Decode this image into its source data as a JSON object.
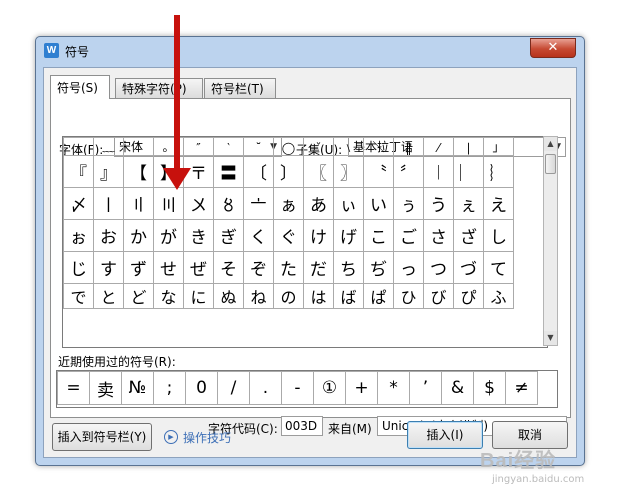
{
  "window": {
    "title": "符号",
    "app_icon_letter": "W",
    "close_glyph": "✕"
  },
  "tabs": [
    {
      "label": "符号(S)",
      "active": true
    },
    {
      "label": "特殊字符(P)",
      "active": false
    },
    {
      "label": "符号栏(T)",
      "active": false
    }
  ],
  "font": {
    "label": "字体(F):",
    "value": "宋体"
  },
  "subset": {
    "label": "子集(U):",
    "value": "基本拉丁语"
  },
  "symbol_grid": {
    "partial_top": [
      "﹍",
      "﹏",
      "ˋ",
      "。",
      "″",
      "‵",
      "˘",
      "◯",
      "ˇ",
      "﹨",
      "＼",
      "‖",
      "⁄",
      "∣",
      "」",
      "╰"
    ],
    "rows": [
      [
        "『",
        "』",
        "【",
        "】",
        "〒",
        "〓",
        "〔",
        "〕",
        "〖",
        "〗",
        "〝",
        "〞",
        "︱",
        "︳",
        "︴"
      ],
      [
        "〆",
        "〡",
        "〢",
        "〣",
        "〤",
        "〥",
        "〦",
        "ぁ",
        "あ",
        "ぃ",
        "い",
        "ぅ",
        "う",
        "ぇ",
        "え"
      ],
      [
        "ぉ",
        "お",
        "か",
        "が",
        "き",
        "ぎ",
        "く",
        "ぐ",
        "け",
        "げ",
        "こ",
        "ご",
        "さ",
        "ざ",
        "し"
      ],
      [
        "じ",
        "す",
        "ず",
        "せ",
        "ぜ",
        "そ",
        "ぞ",
        "た",
        "だ",
        "ち",
        "ぢ",
        "っ",
        "つ",
        "づ",
        "て"
      ]
    ],
    "partial_bottom": [
      "で",
      "と",
      "ど",
      "な",
      "に",
      "ぬ",
      "ね",
      "の",
      "は",
      "ば",
      "ぱ",
      "ひ",
      "び",
      "ぴ",
      "ふ"
    ]
  },
  "recent": {
    "label": "近期使用过的符号(R):",
    "symbols": [
      "=",
      "卖",
      "№",
      ";",
      "0",
      "/",
      ".",
      "-",
      "①",
      "+",
      "*",
      "’",
      "&",
      "$",
      "≠"
    ]
  },
  "char_code": {
    "label": "字符代码(C):",
    "value": "003D"
  },
  "from": {
    "label": "来自(M)",
    "value": "Unicode(十六进制)"
  },
  "buttons": {
    "insert_to_bar": "插入到符号栏(Y)",
    "tips": "操作技巧",
    "insert": "插入(I)",
    "cancel": "取消"
  },
  "watermark": {
    "text": "Bai经验",
    "sub": "jingyan.baidu.com"
  },
  "colors": {
    "annotation_arrow": "#c7110d",
    "title_bg": "#bcd3ee",
    "link": "#3d6fb6"
  }
}
